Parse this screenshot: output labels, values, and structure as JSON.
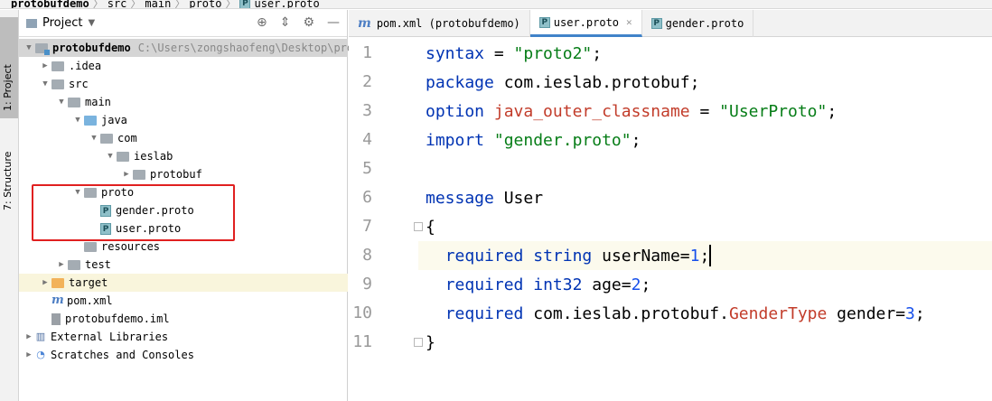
{
  "breadcrumb": [
    "protobufdemo",
    "src",
    "main",
    "proto",
    "user.proto"
  ],
  "stripe": {
    "project_label": "1: Project",
    "structure_label": "7: Structure"
  },
  "panel": {
    "title": "Project"
  },
  "tree": [
    {
      "label": "protobufdemo",
      "extra": "C:\\Users\\zongshaofeng\\Desktop\\pro",
      "indent": 0,
      "arrow": "open",
      "icon": "module-folder",
      "bold": true,
      "selected": true
    },
    {
      "label": ".idea",
      "indent": 1,
      "arrow": "closed",
      "icon": "folder"
    },
    {
      "label": "src",
      "indent": 1,
      "arrow": "open",
      "icon": "folder"
    },
    {
      "label": "main",
      "indent": 2,
      "arrow": "open",
      "icon": "folder"
    },
    {
      "label": "java",
      "indent": 3,
      "arrow": "open",
      "icon": "source-folder"
    },
    {
      "label": "com",
      "indent": 4,
      "arrow": "open",
      "icon": "package"
    },
    {
      "label": "ieslab",
      "indent": 5,
      "arrow": "open",
      "icon": "package"
    },
    {
      "label": "protobuf",
      "indent": 6,
      "arrow": "closed",
      "icon": "package"
    },
    {
      "label": "proto",
      "indent": 3,
      "arrow": "open",
      "icon": "folder"
    },
    {
      "label": "gender.proto",
      "indent": 4,
      "arrow": "none",
      "icon": "proto-file"
    },
    {
      "label": "user.proto",
      "indent": 4,
      "arrow": "none",
      "icon": "proto-file"
    },
    {
      "label": "resources",
      "indent": 3,
      "arrow": "none",
      "icon": "resources-folder"
    },
    {
      "label": "test",
      "indent": 2,
      "arrow": "closed",
      "icon": "folder"
    },
    {
      "label": "target",
      "indent": 1,
      "arrow": "closed",
      "icon": "excluded-folder",
      "highlight": true
    },
    {
      "label": "pom.xml",
      "indent": 1,
      "arrow": "none",
      "icon": "maven-file"
    },
    {
      "label": "protobufdemo.iml",
      "indent": 1,
      "arrow": "none",
      "icon": "iml-file"
    },
    {
      "label": "External Libraries",
      "indent": 0,
      "arrow": "closed",
      "icon": "library-icon"
    },
    {
      "label": "Scratches and Consoles",
      "indent": 0,
      "arrow": "closed",
      "icon": "scratches-icon"
    }
  ],
  "tabs": [
    {
      "label": "pom.xml (protobufdemo)",
      "icon": "maven-icon",
      "active": false
    },
    {
      "label": "user.proto",
      "icon": "proto-icon",
      "active": true
    },
    {
      "label": "gender.proto",
      "icon": "proto-icon",
      "active": false
    }
  ],
  "code_lines": [
    {
      "n": "1",
      "tokens": [
        [
          "kw",
          "syntax"
        ],
        [
          "",
          " = "
        ],
        [
          "str",
          "\"proto2\""
        ],
        [
          "",
          ";"
        ]
      ]
    },
    {
      "n": "2",
      "tokens": [
        [
          "kw",
          "package"
        ],
        [
          "",
          " com.ieslab.protobuf;"
        ]
      ]
    },
    {
      "n": "3",
      "tokens": [
        [
          "kw",
          "option"
        ],
        [
          "",
          " "
        ],
        [
          "red",
          "java_outer_classname"
        ],
        [
          "",
          " = "
        ],
        [
          "str",
          "\"UserProto\""
        ],
        [
          "",
          ";"
        ]
      ]
    },
    {
      "n": "4",
      "tokens": [
        [
          "kw",
          "import"
        ],
        [
          "",
          " "
        ],
        [
          "str",
          "\"gender.proto\""
        ],
        [
          "",
          ";"
        ]
      ]
    },
    {
      "n": "5",
      "tokens": []
    },
    {
      "n": "6",
      "tokens": [
        [
          "kw",
          "message"
        ],
        [
          "",
          " User"
        ]
      ]
    },
    {
      "n": "7",
      "tokens": [
        [
          "",
          "{"
        ]
      ]
    },
    {
      "n": "8",
      "tokens": [
        [
          "",
          "  "
        ],
        [
          "kw",
          "required"
        ],
        [
          "",
          " "
        ],
        [
          "kw",
          "string"
        ],
        [
          "",
          " userName="
        ],
        [
          "num",
          "1"
        ],
        [
          "",
          ";"
        ]
      ],
      "current": true
    },
    {
      "n": "9",
      "tokens": [
        [
          "",
          "  "
        ],
        [
          "kw",
          "required"
        ],
        [
          "",
          " "
        ],
        [
          "kw",
          "int32"
        ],
        [
          "",
          " age="
        ],
        [
          "num",
          "2"
        ],
        [
          "",
          ";"
        ]
      ]
    },
    {
      "n": "10",
      "tokens": [
        [
          "",
          "  "
        ],
        [
          "kw",
          "required"
        ],
        [
          "",
          " com.ieslab.protobuf."
        ],
        [
          "red",
          "GenderType"
        ],
        [
          "",
          " gender="
        ],
        [
          "num",
          "3"
        ],
        [
          "",
          ";"
        ]
      ]
    },
    {
      "n": "11",
      "tokens": [
        [
          "",
          "}"
        ]
      ]
    }
  ]
}
